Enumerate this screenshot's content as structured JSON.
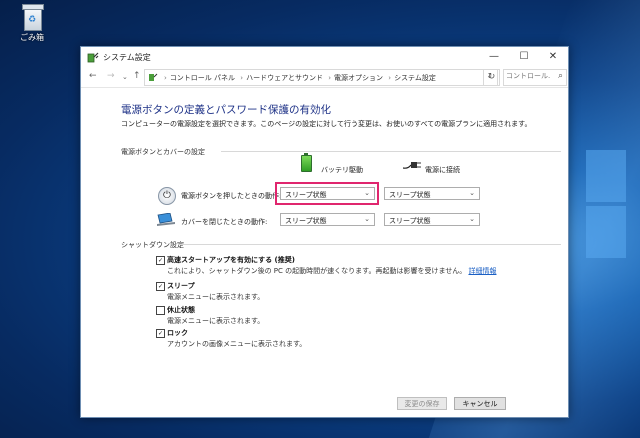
{
  "desktop": {
    "recycle_bin_label": "ごみ箱"
  },
  "window": {
    "title": "システム設定",
    "controls": {
      "minimize": "—",
      "maximize": "☐",
      "close": "✕"
    }
  },
  "address": {
    "breadcrumbs": [
      "コントロール パネル",
      "ハードウェアとサウンド",
      "電源オプション",
      "システム設定"
    ],
    "search_placeholder": "コントロール..."
  },
  "content": {
    "title": "電源ボタンの定義とパスワード保護の有効化",
    "description": "コンピューターの電源設定を選択できます。このページの設定に対して行う変更は、お使いのすべての電源プランに適用されます。",
    "section_power": "電源ボタンとカバーの設定",
    "col_battery": "バッテリ駆動",
    "col_plugged": "電源に接続",
    "row_power_button": "電源ボタンを押したときの動作:",
    "row_lid": "カバーを閉じたときの動作:",
    "selects": {
      "power_battery": "スリープ状態",
      "power_plugged": "スリープ状態",
      "lid_battery": "スリープ状態",
      "lid_plugged": "スリープ状態"
    },
    "section_shutdown": "シャットダウン設定",
    "options": [
      {
        "title": "高速スタートアップを有効にする (推奨)",
        "desc": "これにより、シャットダウン後の PC の起動時間が速くなります。再起動は影響を受けません。",
        "link": "詳細情報",
        "checked": true
      },
      {
        "title": "スリープ",
        "desc": "電源メニューに表示されます。",
        "checked": true
      },
      {
        "title": "休止状態",
        "desc": "電源メニューに表示されます。",
        "checked": false
      },
      {
        "title": "ロック",
        "desc": "アカウントの画像メニューに表示されます。",
        "checked": true
      }
    ],
    "save_button": "変更の保存",
    "cancel_button": "キャンセル"
  },
  "colors": {
    "title_blue": "#1e3287",
    "highlight": "#e0266e",
    "link": "#1a5fc4"
  }
}
